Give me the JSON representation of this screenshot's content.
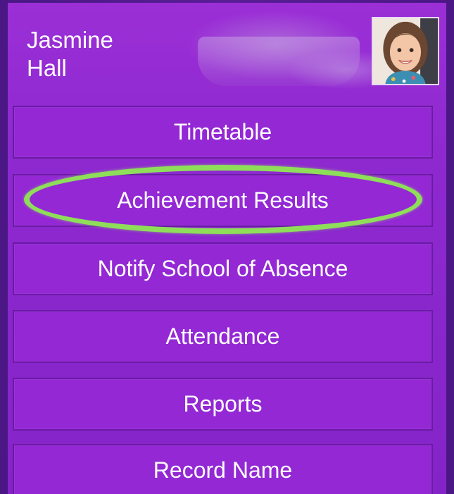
{
  "profile": {
    "name": "Jasmine\nHall",
    "avatar_icon": "student-photo"
  },
  "menu": {
    "items": [
      {
        "label": "Timetable"
      },
      {
        "label": "Achievement Results",
        "highlighted": true
      },
      {
        "label": "Notify School of Absence"
      },
      {
        "label": "Attendance"
      },
      {
        "label": "Reports"
      },
      {
        "label": "Record Name"
      }
    ]
  },
  "colors": {
    "panel": "#9328d4",
    "background": "#3a1166",
    "highlight": "#8ede5a",
    "text": "#ffffff"
  }
}
